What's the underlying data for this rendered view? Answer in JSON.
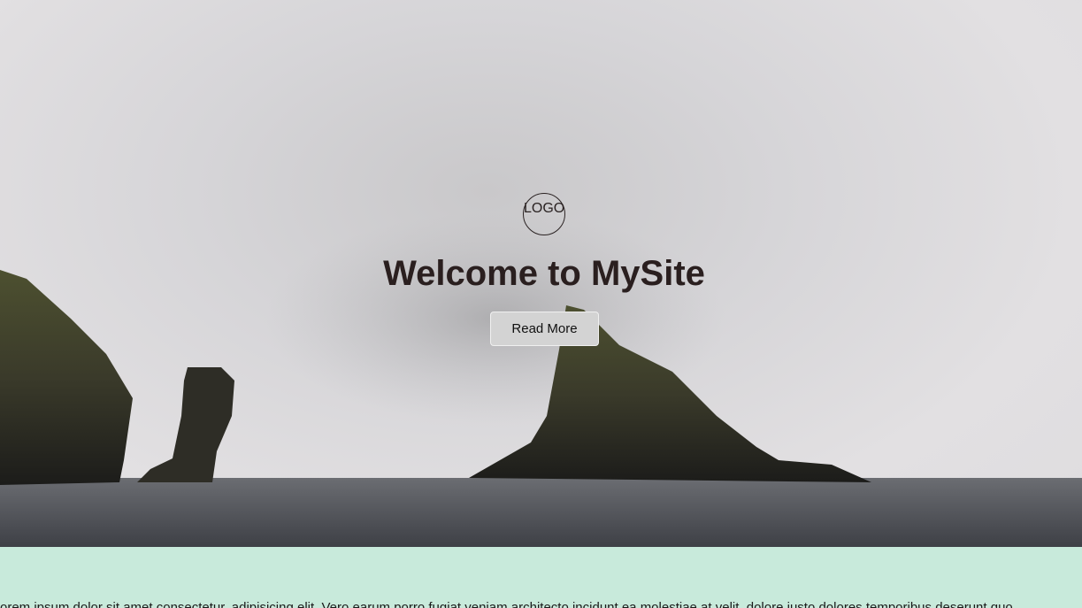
{
  "hero": {
    "logo_text": "LOGO",
    "title": "Welcome to MySite",
    "button_label": "Read More"
  },
  "content": {
    "paragraph": "orem ipsum dolor sit amet consectetur, adipisicing elit. Vero earum porro fugiat veniam architecto incidunt ea molestiae at velit, dolore iusto dolores temporibus deserunt quo"
  },
  "colors": {
    "content_background": "#c8eadb",
    "title": "#2a1f1f",
    "button_background": "#d3d3d3"
  }
}
